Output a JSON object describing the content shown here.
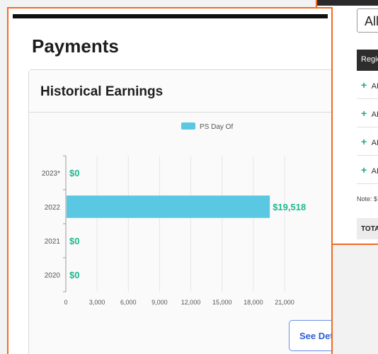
{
  "back_window": {
    "dropdown_value": "All",
    "table_header": "Regio",
    "rows": [
      "AF",
      "AF",
      "AF",
      "AF"
    ],
    "note": "Note: $",
    "total_label": "TOTA"
  },
  "page": {
    "title": "Payments"
  },
  "card": {
    "title": "Historical Earnings",
    "details_button": "See Details",
    "details_chevron": ">"
  },
  "chart_data": {
    "type": "bar",
    "orientation": "horizontal",
    "categories": [
      "2023*",
      "2022",
      "2021",
      "2020"
    ],
    "series": [
      {
        "name": "PS Day Of",
        "values": [
          0,
          19518,
          0,
          0
        ],
        "labels": [
          "$0",
          "$19,518",
          "$0",
          "$0"
        ],
        "color": "#5bc8e3"
      }
    ],
    "xlim": [
      0,
      21000
    ],
    "xticks": [
      0,
      3000,
      6000,
      9000,
      12000,
      15000,
      18000,
      21000
    ],
    "xtick_labels": [
      "0",
      "3,000",
      "6,000",
      "9,000",
      "12,000",
      "15,000",
      "18,000",
      "21,000"
    ],
    "legend_position": "top",
    "grid": true,
    "label_color": "#1fb98f"
  }
}
